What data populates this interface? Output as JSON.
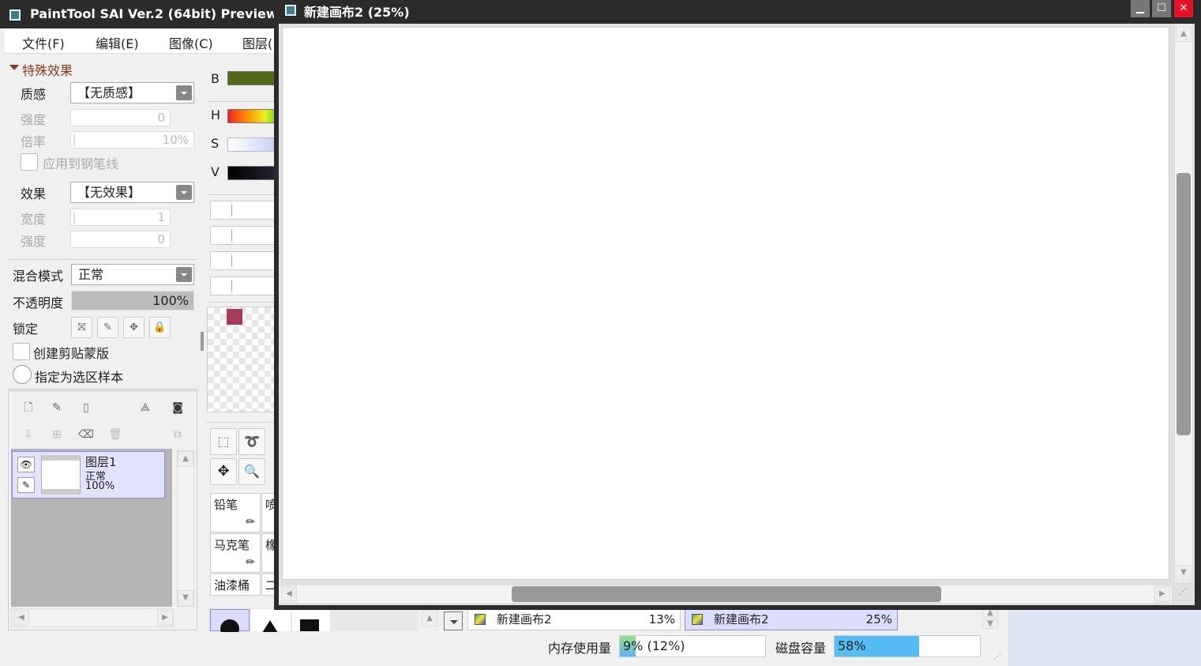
{
  "app": {
    "title": "PaintTool SAI Ver.2 (64bit) Preview."
  },
  "menu": {
    "file": "文件(F)",
    "edit": "编辑(E)",
    "image": "图像(C)",
    "layer": "图层("
  },
  "effects": {
    "section_title": "特殊效果",
    "texture_label": "质感",
    "texture_value": "【无质感】",
    "intensity_label": "强度",
    "intensity_value": "0",
    "scale_label": "倍率",
    "scale_value": "10%",
    "apply_pen_label": "应用到钢笔线",
    "effect_label": "效果",
    "effect_value": "【无效果】",
    "width_label": "宽度",
    "width_value": "1",
    "strength_label": "强度",
    "strength_value": "0"
  },
  "layer_props": {
    "blend_label": "混合模式",
    "blend_value": "正常",
    "opacity_label": "不透明度",
    "opacity_value": "100%",
    "lock_label": "锁定",
    "clip_label": "创建剪贴蒙版",
    "select_sample_label": "指定为选区样本"
  },
  "layers": [
    {
      "name": "图层1",
      "mode": "正常",
      "opacity": "100%"
    }
  ],
  "color": {
    "b_label": "B",
    "h_label": "H",
    "s_label": "S",
    "v_label": "V",
    "swatch": "#a83a5a"
  },
  "tools": {
    "pencil": "铅笔",
    "airbrush": "喷",
    "marker": "马克笔",
    "eraser": "橡",
    "bucket": "油漆桶",
    "binary": "二"
  },
  "canvas_window": {
    "title": "新建画布2 (25%)"
  },
  "tabs": [
    {
      "name": "新建画布2",
      "pct": "13%"
    },
    {
      "name": "新建画布2",
      "pct": "25%"
    }
  ],
  "status": {
    "memory_label": "内存使用量",
    "memory_value": "9% (12%)",
    "memory_fraction": 0.09,
    "disk_label": "磁盘容量",
    "disk_value": "58%",
    "disk_fraction": 0.58
  }
}
